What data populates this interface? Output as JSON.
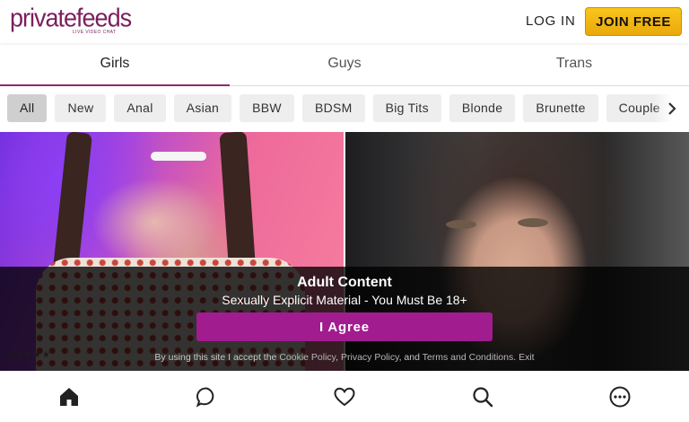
{
  "header": {
    "logo_main": "privatefeeds",
    "logo_sub": "live video chat",
    "login_label": "LOG IN",
    "join_label": "JOIN FREE",
    "brand_color": "#7b1f5e",
    "join_color": "#f4b715"
  },
  "tabs": [
    {
      "label": "Girls",
      "active": true
    },
    {
      "label": "Guys",
      "active": false
    },
    {
      "label": "Trans",
      "active": false
    }
  ],
  "categories": [
    {
      "label": "All",
      "active": true
    },
    {
      "label": "New"
    },
    {
      "label": "Anal"
    },
    {
      "label": "Asian"
    },
    {
      "label": "BBW"
    },
    {
      "label": "BDSM"
    },
    {
      "label": "Big Tits"
    },
    {
      "label": "Blonde"
    },
    {
      "label": "Brunette"
    },
    {
      "label": "Couple"
    }
  ],
  "categories_next_icon": "chevron-right-icon",
  "performers": [
    {
      "rating_stars": "★★★★★"
    },
    {}
  ],
  "overlay": {
    "title": "Adult Content",
    "subtitle": "Sexually Explicit Material - You Must Be 18+",
    "agree_label": "I Agree",
    "agree_color": "#a11c8f",
    "terms_prefix": "By using this site I accept the ",
    "cookie_policy": "Cookie Policy",
    "comma": ", ",
    "privacy_policy": "Privacy Policy",
    "and": ", and ",
    "terms_conditions": "Terms and Conditions",
    "period": ". ",
    "exit": "Exit"
  },
  "bottom_nav": [
    {
      "icon": "home-icon",
      "active": true
    },
    {
      "icon": "chat-bubble-icon"
    },
    {
      "icon": "heart-icon"
    },
    {
      "icon": "search-icon"
    },
    {
      "icon": "more-icon"
    }
  ]
}
